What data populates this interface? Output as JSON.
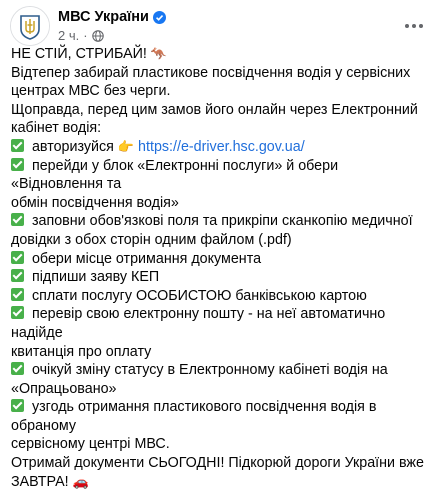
{
  "post": {
    "page_name": "МВС України",
    "time": "2 ч.",
    "dot": "·",
    "icons": {
      "avatar": "ministry-emblem",
      "verified": "verified-badge-icon",
      "audience": "globe-icon",
      "more": "more-options-icon"
    },
    "colors": {
      "link": "#216fdb",
      "check": "#48b04a",
      "verified": "#1877f2",
      "meta": "#65676b"
    },
    "lines": {
      "l1": "НЕ СТІЙ, СТРИБАЙ! ",
      "l1_emoji": "🦘",
      "l2": "Відтепер забирай пластикове посвідчення водія у сервісних",
      "l3": "центрах МВС без черги.",
      "l4": "Щоправда, перед цим замов його онлайн через Електронний",
      "l5": "кабінет водія:",
      "l6": " авторизуйся ",
      "l6_emoji": "👉",
      "l6_link": "https://e-driver.hsc.gov.ua/",
      "l7": " перейди у блок «Електронні послуги» й обери «Відновлення та",
      "l8": "обмін посвідчення водія»",
      "l9": " заповни обов'язкові поля та прикріпи сканкопію медичної",
      "l10": "довідки з обох сторін одним файлом (.pdf)",
      "l11": " обери місце отримання документа",
      "l12": " підпиши заяву КЕП",
      "l13": " сплати послугу ОСОБИСТОЮ банківською картою",
      "l14": " перевір свою електронну пошту - на неї автоматично надійде",
      "l15": "квитанція про оплату",
      "l16": " очікуй зміну статусу в Електронному кабінеті водія на",
      "l17": "«Опрацьовано»",
      "l18": " узгодь отримання пластикового посвідчення водія в обраному",
      "l19": "сервісному центрі МВС.",
      "l20": "Отримай документи СЬОГОДНІ! Підкорюй дороги України вже",
      "l21": "ЗАВТРА! ",
      "l21_emoji": "🚗"
    }
  }
}
